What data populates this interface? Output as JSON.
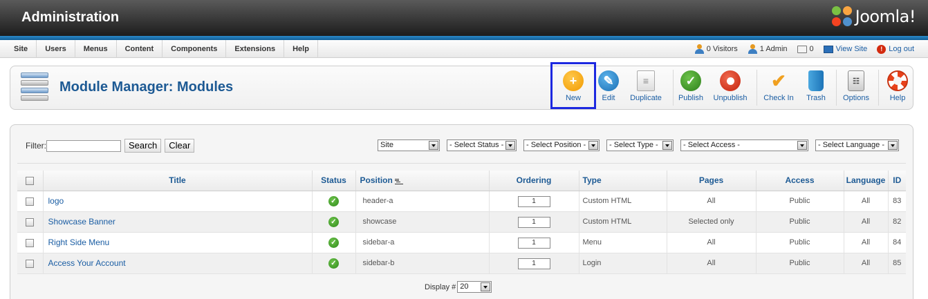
{
  "header": {
    "title": "Administration",
    "brand": "Joomla!"
  },
  "menu": [
    "Site",
    "Users",
    "Menus",
    "Content",
    "Components",
    "Extensions",
    "Help"
  ],
  "status": {
    "visitors": "0 Visitors",
    "admins": "1 Admin",
    "messages": "0",
    "view_site": "View Site",
    "logout": "Log out"
  },
  "page": {
    "title": "Module Manager: Modules"
  },
  "toolbar": {
    "new": "New",
    "edit": "Edit",
    "duplicate": "Duplicate",
    "publish": "Publish",
    "unpublish": "Unpublish",
    "checkin": "Check In",
    "trash": "Trash",
    "options": "Options",
    "help": "Help"
  },
  "filters": {
    "label": "Filter:",
    "value": "",
    "search": "Search",
    "clear": "Clear",
    "client": "Site",
    "status": "- Select Status -",
    "position": "- Select Position -",
    "type": "- Select Type -",
    "access": "- Select Access -",
    "language": "- Select Language -"
  },
  "columns": {
    "title": "Title",
    "status": "Status",
    "position": "Position",
    "ordering": "Ordering",
    "type": "Type",
    "pages": "Pages",
    "access": "Access",
    "language": "Language",
    "id": "ID"
  },
  "rows": [
    {
      "title": "logo",
      "position": "header-a",
      "ordering": "1",
      "type": "Custom HTML",
      "pages": "All",
      "access": "Public",
      "language": "All",
      "id": "83"
    },
    {
      "title": "Showcase Banner",
      "position": "showcase",
      "ordering": "1",
      "type": "Custom HTML",
      "pages": "Selected only",
      "access": "Public",
      "language": "All",
      "id": "82"
    },
    {
      "title": "Right Side Menu",
      "position": "sidebar-a",
      "ordering": "1",
      "type": "Menu",
      "pages": "All",
      "access": "Public",
      "language": "All",
      "id": "84"
    },
    {
      "title": "Access Your Account",
      "position": "sidebar-b",
      "ordering": "1",
      "type": "Login",
      "pages": "All",
      "access": "Public",
      "language": "All",
      "id": "85"
    }
  ],
  "footer": {
    "display_label": "Display #",
    "display_value": "20"
  }
}
